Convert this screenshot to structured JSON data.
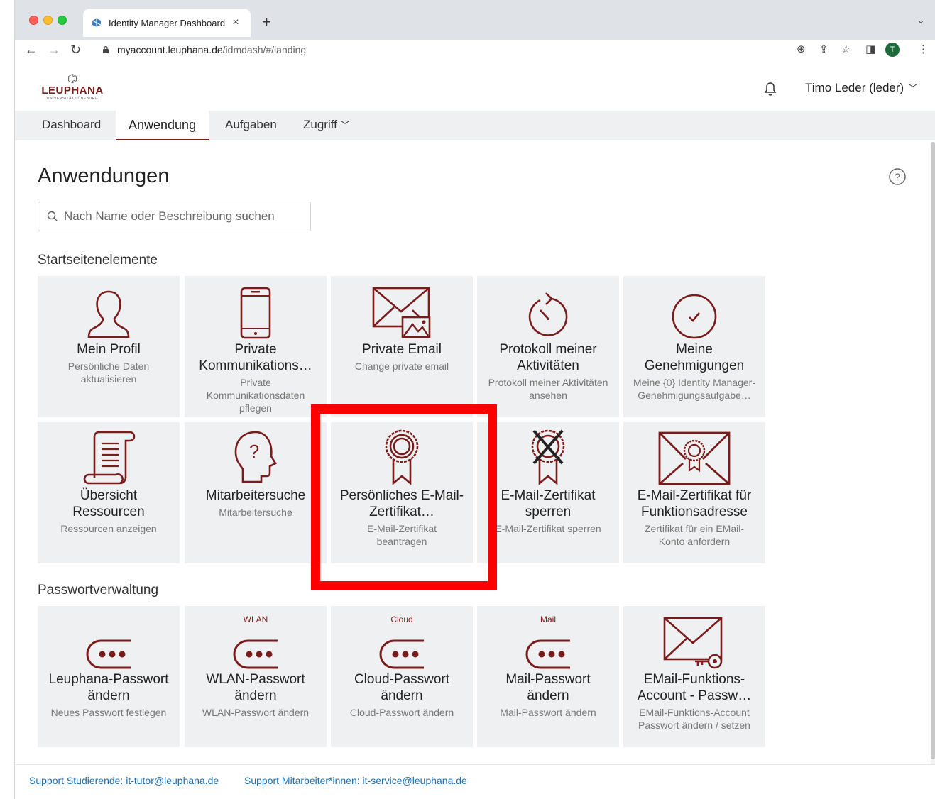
{
  "browser": {
    "tab_title": "Identity Manager Dashboard",
    "url_host": "myaccount.leuphana.de",
    "url_path": "/idmdash/#/landing",
    "profile_initial": "T"
  },
  "header": {
    "logo_text": "LEUPHANA",
    "logo_sub": "UNIVERSITÄT LÜNEBURG",
    "user_name": "Timo Leder (leder)"
  },
  "nav": {
    "items": [
      "Dashboard",
      "Anwendung",
      "Aufgaben",
      "Zugriff"
    ]
  },
  "main": {
    "title": "Anwendungen",
    "search_placeholder": "Nach Name oder Beschreibung suchen",
    "sections": [
      {
        "title": "Startseitenelemente",
        "tiles": [
          {
            "label": "Mein Profil",
            "desc": "Persönliche Daten aktualisieren",
            "icon": "user-icon"
          },
          {
            "label": "Private Kommunikations…",
            "desc": "Private Kommunikationsdaten pflegen",
            "icon": "phone-icon"
          },
          {
            "label": "Private Email",
            "desc": "Change private email",
            "icon": "envelope-image-icon"
          },
          {
            "label": "Protokoll meiner Aktivitäten",
            "desc": "Protokoll meiner Aktivitäten ansehen",
            "icon": "history-icon"
          },
          {
            "label": "Meine Genehmigungen",
            "desc": "Meine {0} Identity Manager-Genehmigungsaufgabe…",
            "icon": "check-circle-icon"
          },
          {
            "label": "Übersicht Ressourcen",
            "desc": "Ressourcen anzeigen",
            "icon": "scroll-icon"
          },
          {
            "label": "Mitarbeitersuche",
            "desc": "Mitarbeitersuche",
            "icon": "head-question-icon"
          },
          {
            "label": "Persönliches E-Mail-Zertifikat…",
            "desc": "E-Mail-Zertifikat beantragen",
            "icon": "certificate-icon"
          },
          {
            "label": "E-Mail-Zertifikat sperren",
            "desc": "E-Mail-Zertifikat sperren",
            "icon": "certificate-revoke-icon"
          },
          {
            "label": "E-Mail-Zertifikat für Funktionsadresse",
            "desc": "Zertifikat für ein EMail-Konto anfordern",
            "icon": "envelope-certificate-icon"
          }
        ]
      },
      {
        "title": "Passwortverwaltung",
        "tiles": [
          {
            "label": "Leuphana-Passwort ändern",
            "desc": "Neues Passwort festlegen",
            "tag": "",
            "icon": "password-icon"
          },
          {
            "label": "WLAN-Passwort ändern",
            "desc": "WLAN-Passwort ändern",
            "tag": "WLAN",
            "icon": "password-icon"
          },
          {
            "label": "Cloud-Passwort ändern",
            "desc": "Cloud-Passwort ändern",
            "tag": "Cloud",
            "icon": "password-icon"
          },
          {
            "label": "Mail-Passwort ändern",
            "desc": "Mail-Passwort ändern",
            "tag": "Mail",
            "icon": "password-icon"
          },
          {
            "label": "EMail-Funktions-Account - Passw…",
            "desc": "EMail-Funktions-Account Passwort ändern / setzen",
            "tag": "",
            "icon": "envelope-key-icon"
          }
        ]
      }
    ]
  },
  "footer": {
    "links": [
      "Support Studierende: it-tutor@leuphana.de",
      "Support Mitarbeiter*innen: it-service@leuphana.de"
    ]
  },
  "colors": {
    "accent": "#7a1c1c",
    "tile_bg": "#eef0f1",
    "highlight": "#ff0000",
    "link": "#1a6fb5"
  }
}
